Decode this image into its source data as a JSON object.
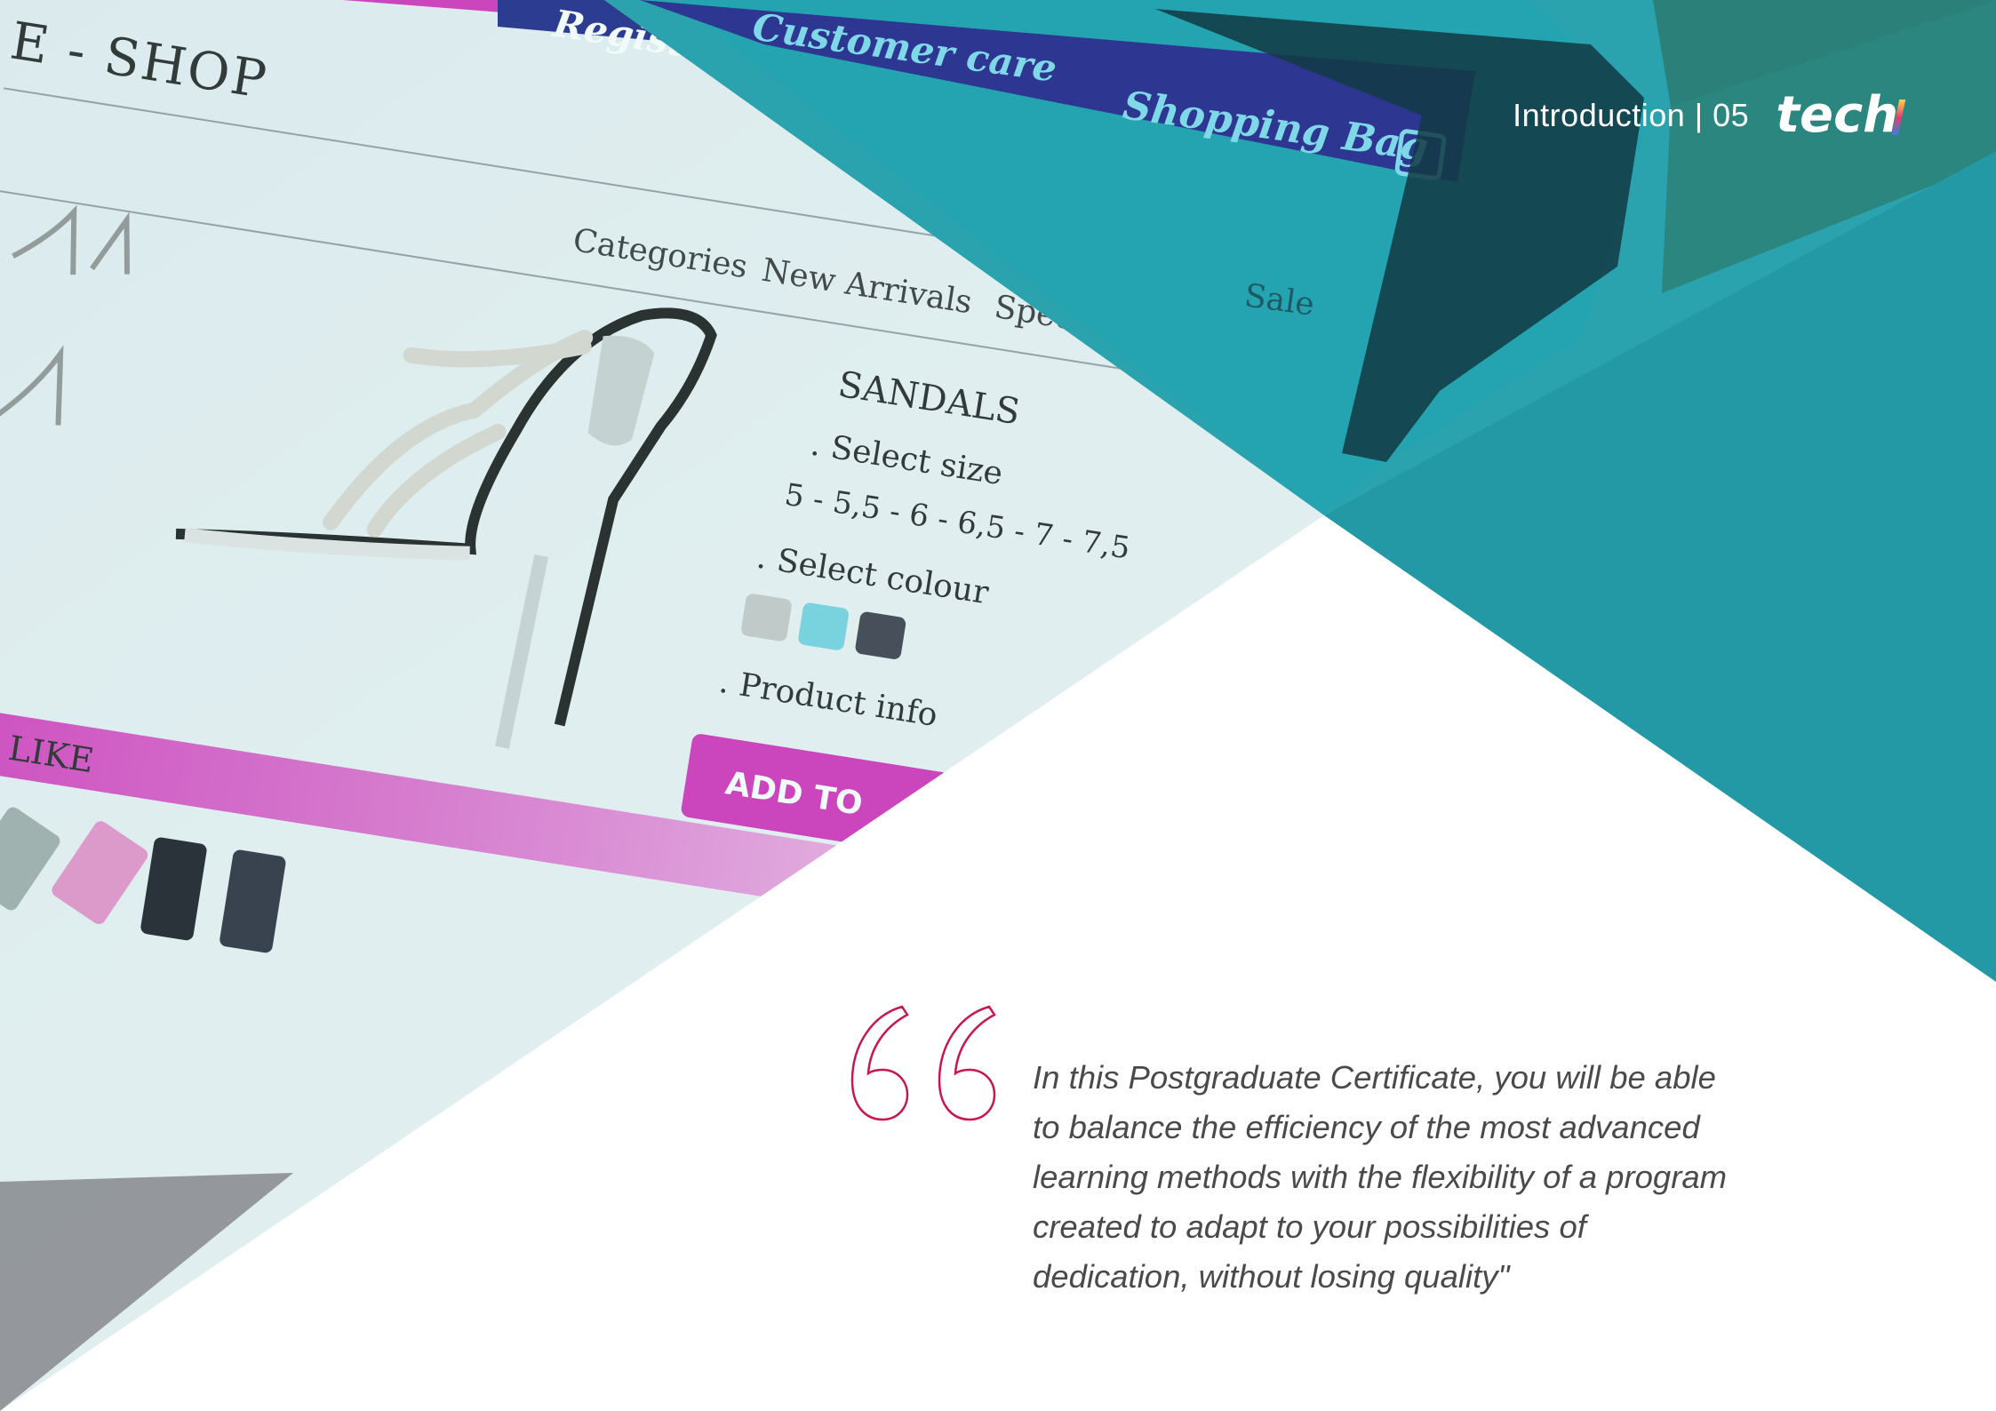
{
  "header": {
    "section_label": "Introduction | 05",
    "logo_text": "tech"
  },
  "photo": {
    "nav_top": [
      "Register",
      "Customer care",
      "Shopping Bag"
    ],
    "shop_title": "E - SHOP",
    "categories": [
      "Categories",
      "New Arrivals",
      "Special Editions",
      "Sale"
    ],
    "product_heading": "SANDALS",
    "select_size_label": ". Select size",
    "sizes": "5 - 5,5 - 6 - 6,5 - 7 - 7,5",
    "select_colour_label": ". Select colour",
    "product_info_label": ". Product info",
    "add_button": "ADD TO",
    "also_like": "ALSO LIKE"
  },
  "quote": {
    "text": "In this Postgraduate Certificate, you will be able to balance the efficiency of the most advanced learning methods with the flexibility of a program created to adapt to your possibilities of dedication, without losing quality\""
  },
  "colors": {
    "teal": "#2aa3ae",
    "teal_dark": "#1b8f98",
    "quote_mark": "#c8174f",
    "magenta": "#d63fbf",
    "nav_blue": "#2d3690"
  }
}
